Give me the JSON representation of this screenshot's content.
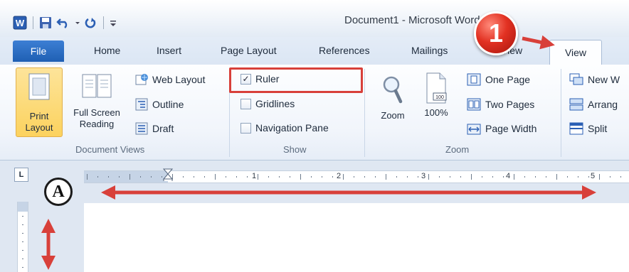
{
  "window": {
    "title": "Document1 - Microsoft Word"
  },
  "qat": {
    "app_icon": "word-icon",
    "save_icon": "save-icon",
    "undo_icon": "undo-icon",
    "redo_icon": "redo-icon",
    "customize_icon": "customize-qat-icon"
  },
  "tabs": [
    {
      "label": "File"
    },
    {
      "label": "Home"
    },
    {
      "label": "Insert"
    },
    {
      "label": "Page Layout"
    },
    {
      "label": "References"
    },
    {
      "label": "Mailings"
    },
    {
      "label": "View"
    },
    {
      "label": "View"
    }
  ],
  "ribbon": {
    "document_views": {
      "label": "Document Views",
      "print_layout": [
        "Print",
        "Layout"
      ],
      "full_screen": [
        "Full Screen",
        "Reading"
      ],
      "web_layout": "Web Layout",
      "outline": "Outline",
      "draft": "Draft"
    },
    "show": {
      "label": "Show",
      "ruler": {
        "label": "Ruler",
        "checked": true
      },
      "gridlines": {
        "label": "Gridlines",
        "checked": false
      },
      "navigation_pane": {
        "label": "Navigation Pane",
        "checked": false
      }
    },
    "zoom": {
      "label": "Zoom",
      "zoom": "Zoom",
      "hundred": "100%",
      "one_page": "One Page",
      "two_pages": "Two Pages",
      "page_width": "Page Width"
    },
    "window": {
      "new_window": "New W",
      "arrange": "Arrang",
      "split": "Split"
    }
  },
  "ruler": {
    "tab_selector": "L",
    "numbers": [
      "1",
      "2",
      "3",
      "4",
      "5"
    ]
  },
  "callouts": {
    "a": "A",
    "one": "1"
  },
  "colors": {
    "accent": "#2a6cc4",
    "highlight": "#d8403a",
    "active_button": "#fcd25e"
  }
}
